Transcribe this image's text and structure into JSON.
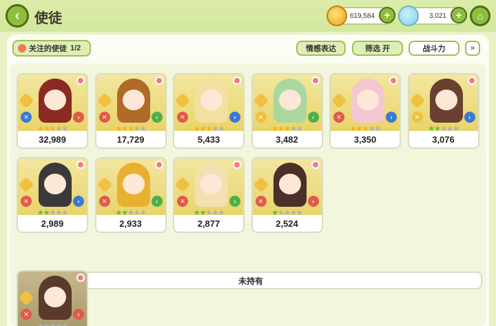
{
  "header": {
    "title": "使徒",
    "gold": "619,584",
    "gems": "3,021"
  },
  "filters": {
    "favorite_label": "关注的使徒",
    "favorite_count": "1/2",
    "emotion_label": "情感表达",
    "filter_label": "筛选 开",
    "sort_label": "战斗力"
  },
  "owned": [
    {
      "power": "32,989",
      "stars": 3,
      "star_color": "gold",
      "hair": "#8a2a22",
      "role_color": "#3a7ad6",
      "arrow_color": "#e05a4a"
    },
    {
      "power": "17,729",
      "stars": 3,
      "star_color": "gold",
      "hair": "#b06a2a",
      "role_color": "#e05a4a",
      "arrow_color": "#4ab04a"
    },
    {
      "power": "5,433",
      "stars": 3,
      "star_color": "gold",
      "hair": "#f2e0a0",
      "role_color": "#e05a4a",
      "arrow_color": "#3a7ad6"
    },
    {
      "power": "3,482",
      "stars": 3,
      "star_color": "gold",
      "hair": "#a8d8a0",
      "role_color": "#f0c040",
      "arrow_color": "#4ab04a"
    },
    {
      "power": "3,350",
      "stars": 3,
      "star_color": "gold",
      "hair": "#f4c8d0",
      "role_color": "#e05a4a",
      "arrow_color": "#3a7ad6"
    },
    {
      "power": "3,076",
      "stars": 2,
      "star_color": "green",
      "hair": "#6a4030",
      "role_color": "#f0c040",
      "arrow_color": "#3a7ad6"
    },
    {
      "power": "2,989",
      "stars": 2,
      "star_color": "green",
      "hair": "#3a3a3a",
      "role_color": "#e05a4a",
      "arrow_color": "#3a7ad6"
    },
    {
      "power": "2,933",
      "stars": 2,
      "star_color": "green",
      "hair": "#e8b030",
      "role_color": "#e05a4a",
      "arrow_color": "#4ab04a"
    },
    {
      "power": "2,877",
      "stars": 2,
      "star_color": "green",
      "hair": "#f2e0b0",
      "role_color": "#e05a4a",
      "arrow_color": "#4ab04a"
    },
    {
      "power": "2,524",
      "stars": 1,
      "star_color": "green",
      "hair": "#4a3028",
      "role_color": "#e05a4a",
      "arrow_color": "#e05a4a"
    }
  ],
  "not_owned_label": "未持有",
  "not_owned": [
    {
      "hair": "#5a3a2a"
    }
  ]
}
